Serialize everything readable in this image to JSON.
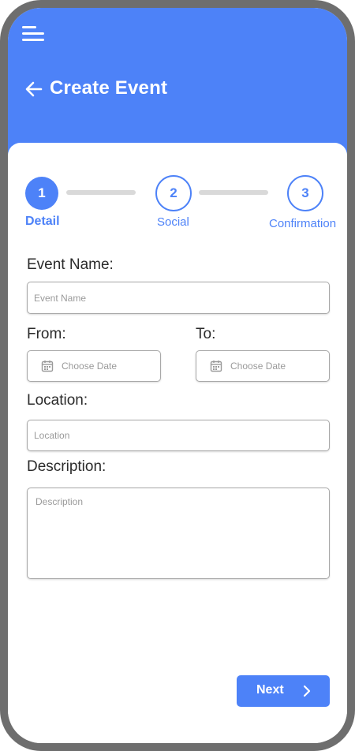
{
  "header": {
    "title": "Create Event",
    "menu_icon": "hamburger-menu-icon",
    "back_icon": "arrow-left-icon",
    "color": "#4d82f8"
  },
  "stepper": {
    "steps": [
      {
        "number": "1",
        "label": "Detail",
        "state": "active"
      },
      {
        "number": "2",
        "label": "Social",
        "state": "inactive"
      },
      {
        "number": "3",
        "label": "Confirmation",
        "state": "inactive"
      }
    ]
  },
  "form": {
    "event_name": {
      "label": "Event Name:",
      "placeholder": "Event Name"
    },
    "from": {
      "label": "From:",
      "placeholder": "Choose Date",
      "icon": "calendar-icon"
    },
    "to": {
      "label": "To:",
      "placeholder": "Choose Date",
      "icon": "calendar-icon"
    },
    "location": {
      "label": "Location:",
      "placeholder": "Location"
    },
    "description": {
      "label": "Description:",
      "placeholder": "Description"
    }
  },
  "footer": {
    "next_label": "Next",
    "next_icon": "chevron-right-icon"
  }
}
